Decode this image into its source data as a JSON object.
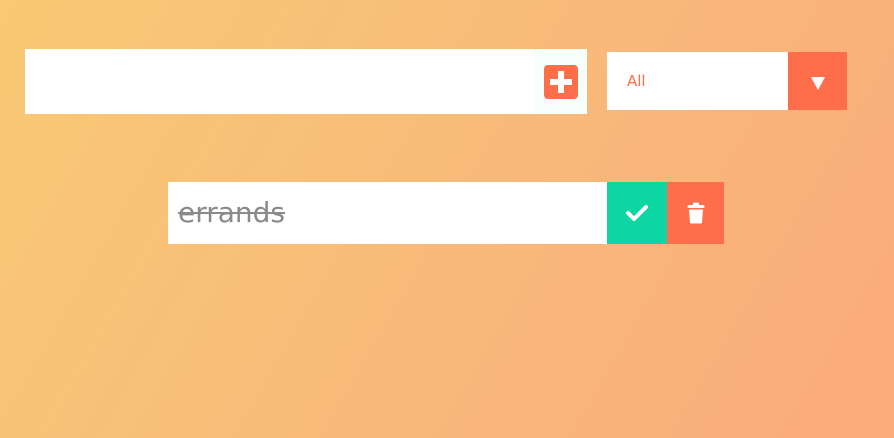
{
  "form": {
    "input_value": "",
    "add_button_icon": "plus-square-icon"
  },
  "filter": {
    "selected": "All",
    "options": [
      "All"
    ],
    "arrow_icon": "triangle-down-icon"
  },
  "todos": [
    {
      "text": "errands",
      "completed": true,
      "check_icon": "check-icon",
      "trash_icon": "trash-icon"
    }
  ],
  "colors": {
    "accent": "#ff6e4a",
    "complete": "#0dd6a3",
    "completed_text": "#8a8a8a",
    "background_start": "#f9c974",
    "background_end": "#fbaa7a"
  }
}
